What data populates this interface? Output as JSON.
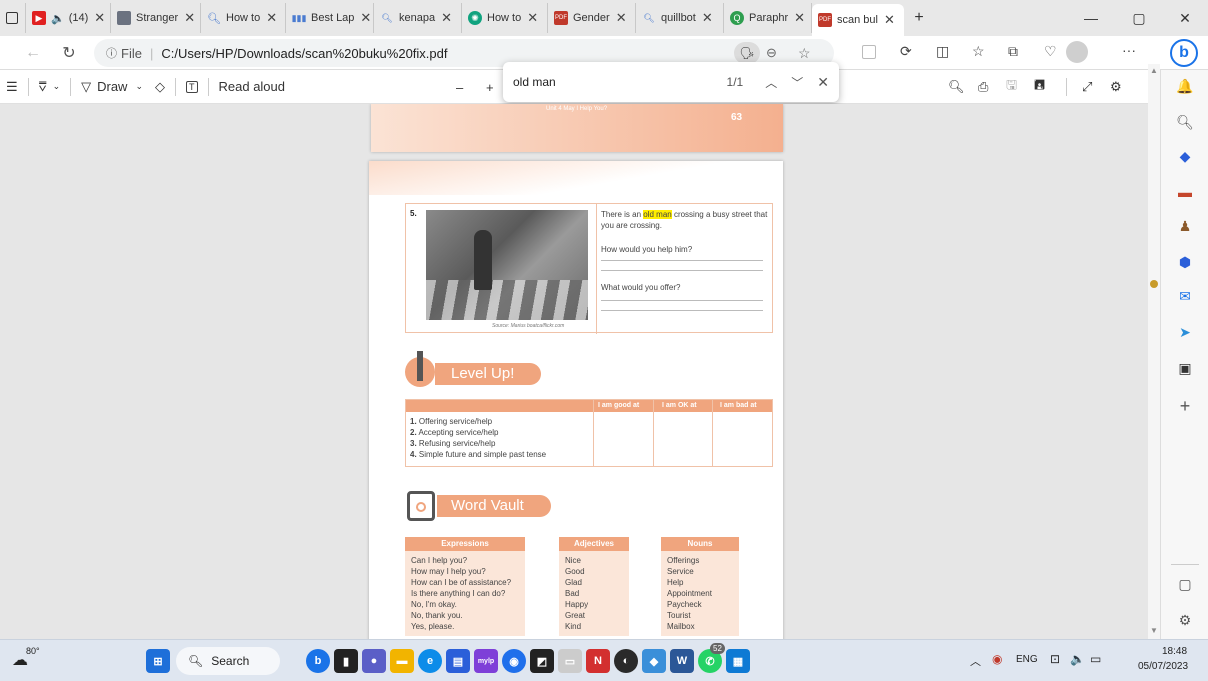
{
  "tabs": [
    {
      "label": "",
      "icon": "tab-actions-icon",
      "color": "#333333"
    },
    {
      "label": "(14)",
      "icon": "youtube-icon",
      "color": "#e02020"
    },
    {
      "label": "Stranger",
      "icon": "page-icon",
      "color": "#6b7280"
    },
    {
      "label": "How to",
      "icon": "search-icon",
      "color": "#4a7bd0"
    },
    {
      "label": "Best Lap",
      "icon": "bars-icon",
      "color": "#4a7bd0"
    },
    {
      "label": "kenapa",
      "icon": "search-icon",
      "color": "#4a7bd0"
    },
    {
      "label": "How to",
      "icon": "chatgpt-icon",
      "color": "#10a37f"
    },
    {
      "label": "Gender",
      "icon": "pdf-icon",
      "color": "#c0392b"
    },
    {
      "label": "quillbot",
      "icon": "search-icon",
      "color": "#4a7bd0"
    },
    {
      "label": "Paraphr",
      "icon": "quillbot-icon",
      "color": "#2e9e4f"
    },
    {
      "label": "scan bul",
      "icon": "pdf-icon",
      "color": "#c0392b"
    }
  ],
  "window": {
    "minimize": "—",
    "restore": "▢",
    "close": "✕"
  },
  "address": {
    "prefix": "File",
    "url": "C:/Users/HP/Downloads/scan%20buku%20fix.pdf"
  },
  "pdf_toolbar": {
    "draw_label": "Draw",
    "read_aloud_label": "Read aloud",
    "minus": "–",
    "plus": "+"
  },
  "find": {
    "query": "old man",
    "count": "1/1"
  },
  "doc": {
    "top_caption": "Unit 4 May I Help You?",
    "top_page_number": "63",
    "q_number": "5.",
    "q_text_before": "There is an ",
    "q_text_highlight": "old man",
    "q_text_after": " crossing a busy street that you are crossing.",
    "q_help": "How would you help him?",
    "q_offer": "What would you offer?",
    "photo_source": "Source: Marius boatca/flickr.com",
    "level_up_title": "Level Up!",
    "level_cols": [
      "I am good at",
      "I am OK at",
      "I am bad at"
    ],
    "level_items": [
      {
        "n": "1.",
        "t": "Offering service/help"
      },
      {
        "n": "2.",
        "t": "Accepting service/help"
      },
      {
        "n": "3.",
        "t": "Refusing service/help"
      },
      {
        "n": "4.",
        "t": "Simple future and simple past tense"
      }
    ],
    "word_vault_title": "Word Vault",
    "expressions_head": "Expressions",
    "expressions": [
      "Can I help you?",
      "How may I help you?",
      "How can I be of assistance?",
      "Is there anything I can do?",
      "No, I'm okay.",
      "No, thank you.",
      "Yes, please."
    ],
    "adjectives_head": "Adjectives",
    "adjectives": [
      "Nice",
      "Good",
      "Glad",
      "Bad",
      "Happy",
      "Great",
      "Kind"
    ],
    "nouns_head": "Nouns",
    "nouns": [
      "Offerings",
      "Service",
      "Help",
      "Appointment",
      "Paycheck",
      "Tourist",
      "Mailbox"
    ]
  },
  "taskbar": {
    "weather": "80°",
    "search_label": "Search",
    "tray_lang": "ENG",
    "time": "18:48",
    "date": "05/07/2023",
    "whatsapp_badge": "52"
  },
  "colors": {
    "accent": "#f0a57e",
    "highlight": "#ffee00",
    "edge_blue": "#1a73e8"
  }
}
